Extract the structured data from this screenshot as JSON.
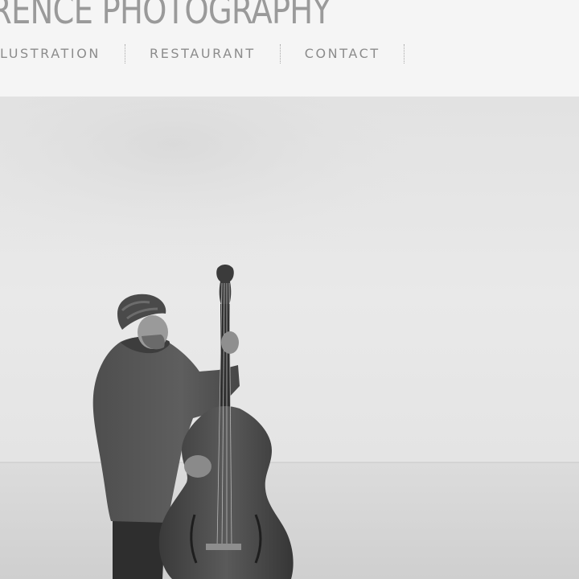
{
  "site": {
    "title": "RENCE PHOTOGRAPHY"
  },
  "nav": {
    "items": [
      {
        "label": "LUSTRATION"
      },
      {
        "label": "RESTAURANT"
      },
      {
        "label": "CONTACT"
      }
    ]
  },
  "hero": {
    "subject": "man playing upright double bass by the sea",
    "style": "black-and-white"
  },
  "colors": {
    "header_bg": "#f5f5f5",
    "title_text": "#9a9a9a",
    "nav_text": "#8c8c8c",
    "sky": "#e6e6e6",
    "sea": "#d9d9d9"
  }
}
